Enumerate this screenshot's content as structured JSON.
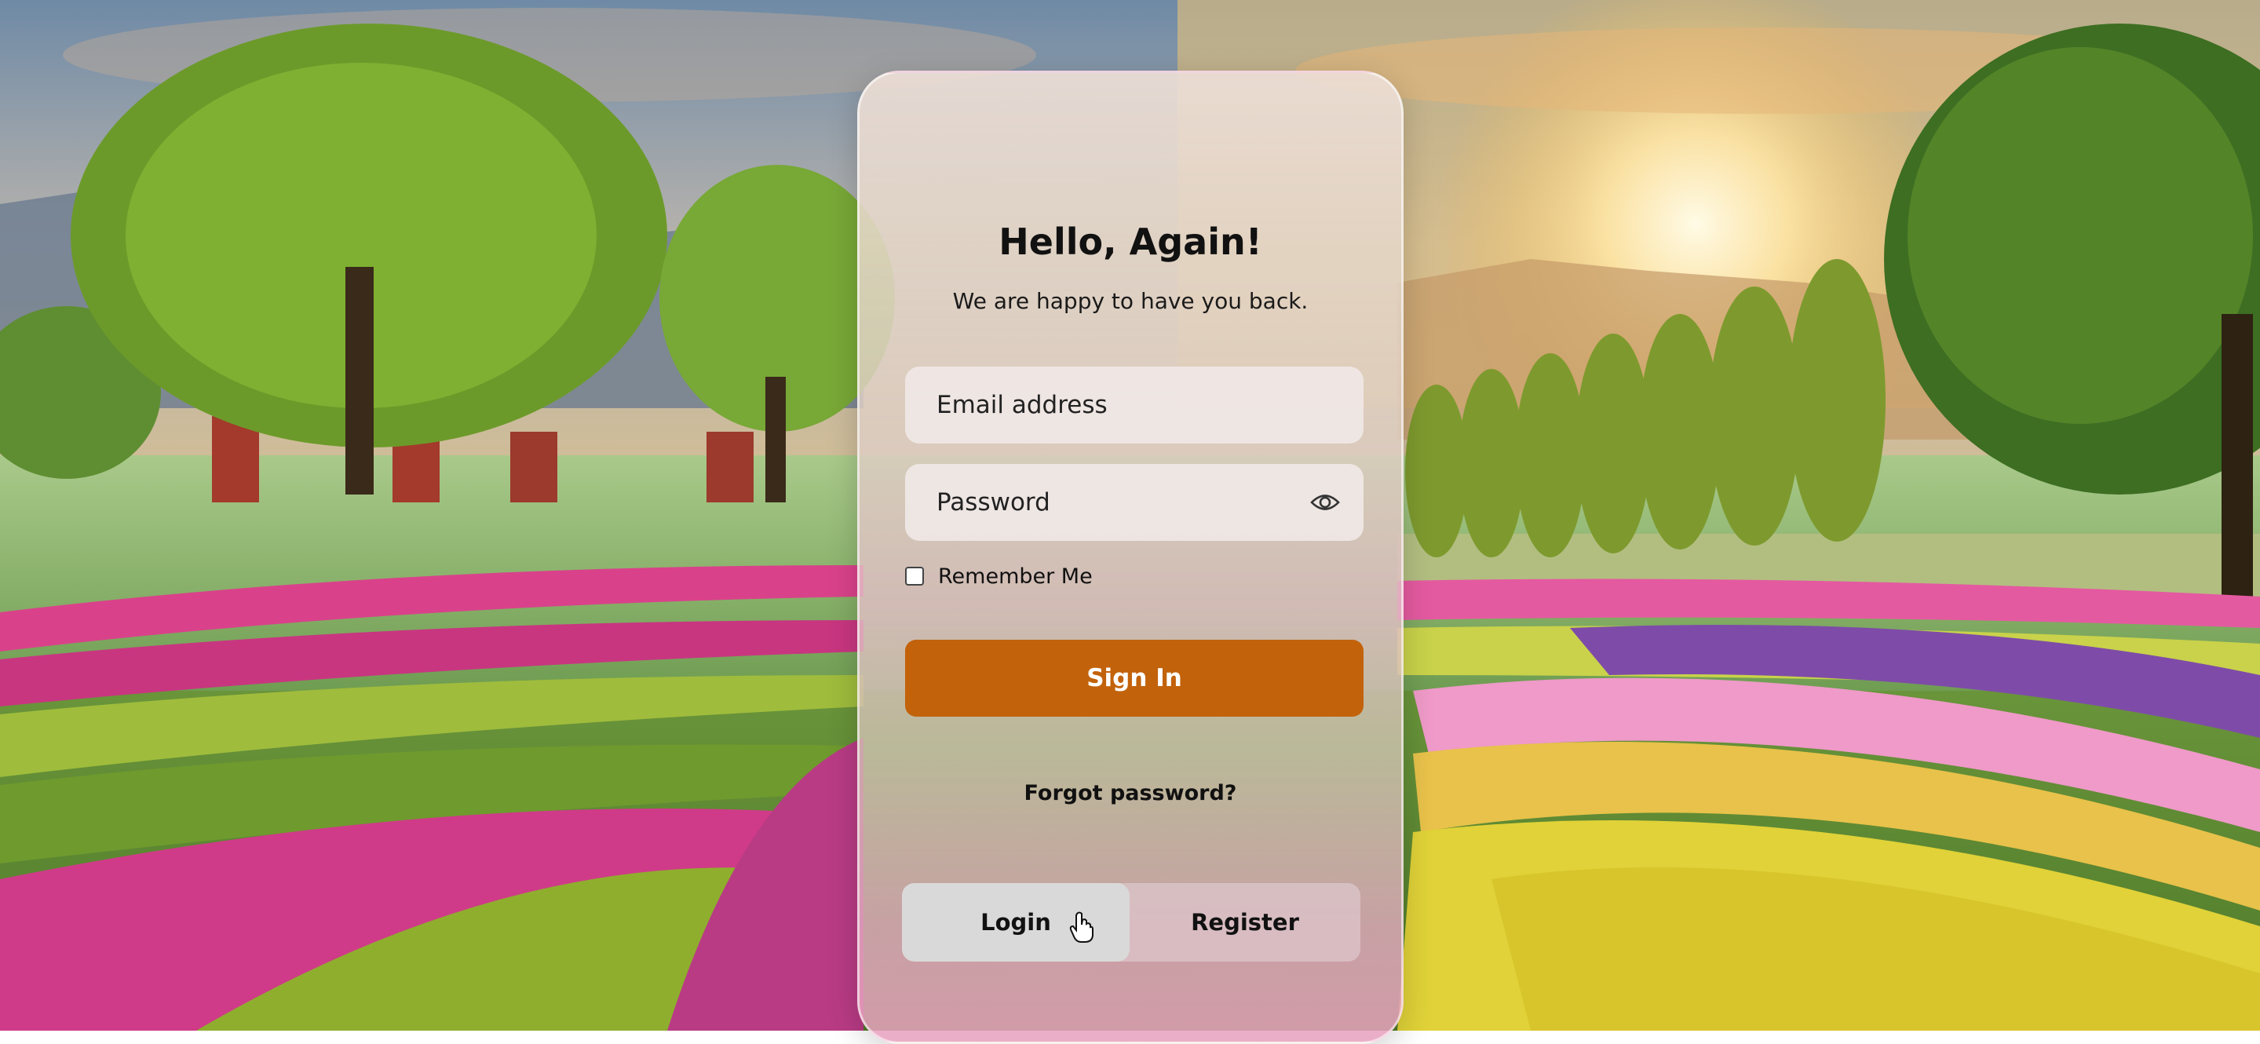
{
  "login_card": {
    "title": "Hello, Again!",
    "subtitle": "We are happy to have you back.",
    "email_placeholder": "Email address",
    "password_placeholder": "Password",
    "password_toggle_icon": "eye-icon",
    "remember_label": "Remember Me",
    "remember_checked": false,
    "sign_in_label": "Sign In",
    "forgot_label": "Forgot password?",
    "tabs": [
      {
        "label": "Login",
        "active": true
      },
      {
        "label": "Register",
        "active": false
      }
    ]
  },
  "background": {
    "description_icon": "landscape-background"
  },
  "colors": {
    "accent": "#c2620a",
    "card_tint": "#e4d6cc",
    "text": "#111111"
  }
}
